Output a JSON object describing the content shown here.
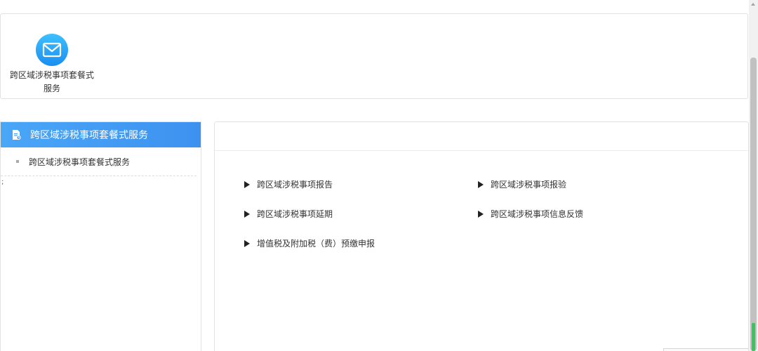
{
  "top_panel": {
    "service_tile": {
      "icon": "mail-icon",
      "label": "跨区域涉税事项套餐式服务",
      "icon_color": "#1a8ef0"
    }
  },
  "sidebar": {
    "header": {
      "icon": "document-icon",
      "label": "跨区域涉税事项套餐式服务",
      "bg_color": "#4a9ff5"
    },
    "items": [
      {
        "label": "跨区域涉税事项套餐式服务"
      }
    ],
    "stray_text": ";"
  },
  "content": {
    "links": [
      {
        "label": "跨区域涉税事项报告"
      },
      {
        "label": "跨区域涉税事项报验"
      },
      {
        "label": "跨区域涉税事项延期"
      },
      {
        "label": "跨区域涉税事项信息反馈"
      },
      {
        "label": "增值税及附加税（费）预缴申报"
      }
    ]
  },
  "colors": {
    "accent": "#4a9ff5",
    "scroll_indicator": "#34c759"
  }
}
